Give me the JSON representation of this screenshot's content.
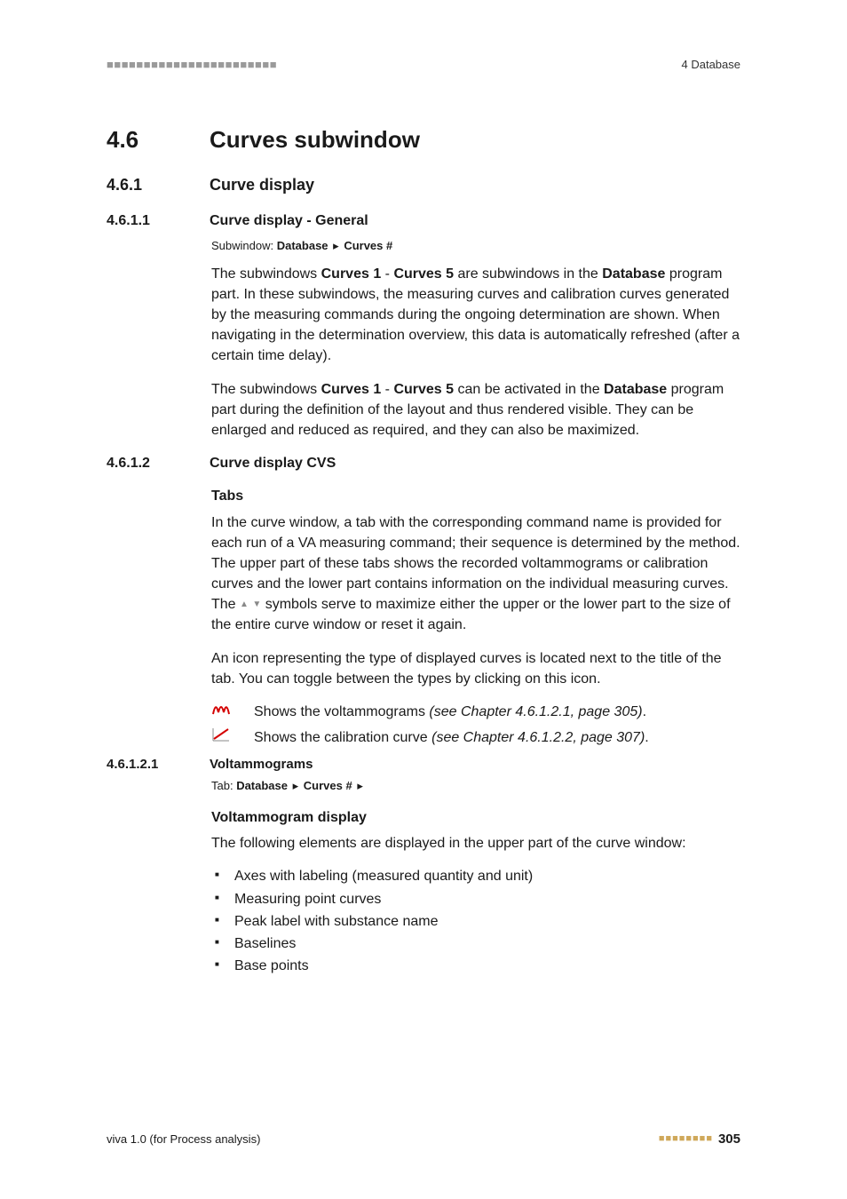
{
  "header": {
    "bars": "■■■■■■■■■■■■■■■■■■■■■■■",
    "right": "4 Database"
  },
  "sec": {
    "h1_num": "4.6",
    "h1_title": "Curves subwindow",
    "h2_num": "4.6.1",
    "h2_title": "Curve display",
    "h3a_num": "4.6.1.1",
    "h3a_title": "Curve display - General",
    "subwindow_prefix": "Subwindow: ",
    "subwindow_bold1": "Database",
    "subwindow_arrow": "▸",
    "subwindow_bold2": "Curves #",
    "p1a": "The subwindows ",
    "p1_b1": "Curves 1",
    "p1_dash": " - ",
    "p1_b2": "Curves 5",
    "p1b": " are subwindows in the ",
    "p1_b3": "Database",
    "p1c": " program part. In these subwindows, the measuring curves and calibration curves generated by the measuring commands during the ongoing determination are shown. When navigating in the determination overview, this data is automatically refreshed (after a certain time delay).",
    "p2a": "The subwindows ",
    "p2_b1": "Curves 1",
    "p2_dash": " - ",
    "p2_b2": "Curves 5",
    "p2b": " can be activated in the ",
    "p2_b3": "Database",
    "p2c": " program part during the definition of the layout and thus rendered visible. They can be enlarged and reduced as required, and they can also be maximized.",
    "h3b_num": "4.6.1.2",
    "h3b_title": "Curve display CVS",
    "tabs_heading": "Tabs",
    "tabs_p1a": "In the curve window, a tab with the corresponding command name is provided for each run of a VA measuring command; their sequence is determined by the method. The upper part of these tabs shows the recorded voltammograms or calibration curves and the lower part contains information on the individual measuring curves. The ",
    "tabs_p1b": " symbols serve to maximize either the upper or the lower part to the size of the entire curve window or reset it again.",
    "tabs_p2": "An icon representing the type of displayed curves is located next to the title of the tab. You can toggle between the types by clicking on this icon.",
    "iconrow1_text": "Shows the voltammograms ",
    "iconrow1_ref": "(see Chapter 4.6.1.2.1, page 305)",
    "iconrow1_dot": ".",
    "iconrow2_text": "Shows the calibration curve ",
    "iconrow2_ref": "(see Chapter 4.6.1.2.2, page 307)",
    "iconrow2_dot": ".",
    "h4_num": "4.6.1.2.1",
    "h4_title": "Voltammograms",
    "tab_prefix": "Tab: ",
    "tab_bold1": "Database",
    "tab_arrow": "▸",
    "tab_bold2": "Curves #",
    "tab_arrow2": "▸",
    "volt_heading": "Voltammogram display",
    "volt_p": "The following elements are displayed in the upper part of the curve window:",
    "bullets": {
      "b1": "Axes with labeling (measured quantity and unit)",
      "b2": "Measuring point curves",
      "b3": "Peak label with substance name",
      "b4": "Baselines",
      "b5": "Base points"
    }
  },
  "footer": {
    "left": "viva 1.0 (for Process analysis)",
    "bars": "■■■■■■■■",
    "page": "305"
  },
  "icons": {
    "tri_up": "▲",
    "tri_down": "▼"
  }
}
